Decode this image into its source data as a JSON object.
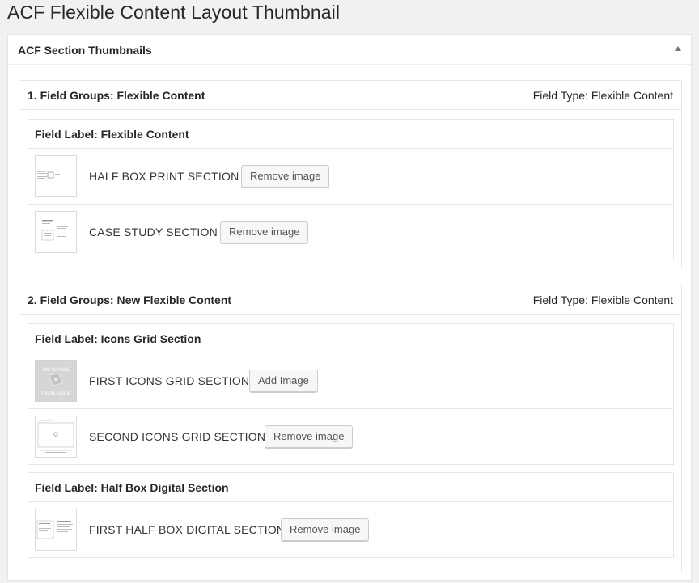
{
  "page": {
    "title": "ACF Flexible Content Layout Thumbnail"
  },
  "metabox": {
    "title": "ACF Section Thumbnails",
    "toggle_icon": "triangle-up-icon"
  },
  "groups": [
    {
      "title": "1. Field Groups: Flexible Content",
      "type_text": "Field Type: Flexible Content",
      "fields": [
        {
          "label": "Field Label: Flexible Content",
          "rows": [
            {
              "name": "HALF BOX PRINT SECTION",
              "button": "Remove image",
              "thumb": "layout-thumbnail"
            },
            {
              "name": "CASE STUDY SECTION",
              "button": "Remove image",
              "thumb": "layout-thumbnail"
            }
          ]
        }
      ]
    },
    {
      "title": "2. Field Groups: New Flexible Content",
      "type_text": "Field Type: Flexible Content",
      "fields": [
        {
          "label": "Field Label: Icons Grid Section",
          "rows": [
            {
              "name": "FIRST ICONS GRID SECTION",
              "button": "Add Image",
              "thumb": "no-image-placeholder",
              "thumb_text_1": "NO IMAGE",
              "thumb_text_2": "AVAILABLE"
            },
            {
              "name": "SECOND ICONS GRID SECTION",
              "button": "Remove image",
              "thumb": "layout-thumbnail"
            }
          ]
        },
        {
          "label": "Field Label: Half Box Digital Section",
          "rows": [
            {
              "name": "FIRST HALF BOX DIGITAL SECTION",
              "button": "Remove image",
              "thumb": "layout-thumbnail"
            }
          ]
        }
      ]
    }
  ]
}
